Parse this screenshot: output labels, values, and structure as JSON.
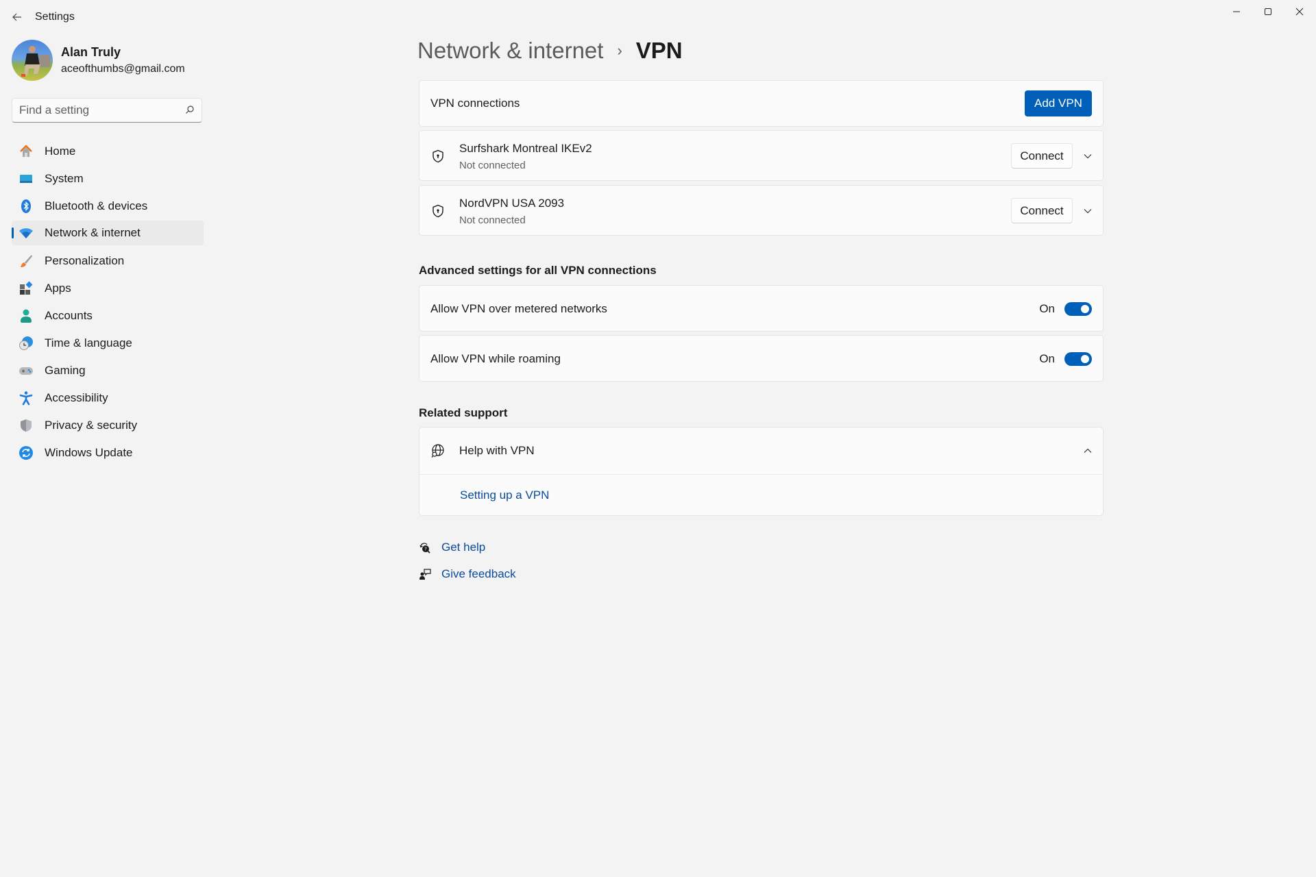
{
  "window": {
    "title": "Settings",
    "controls": [
      "minimize",
      "maximize",
      "close"
    ]
  },
  "profile": {
    "name": "Alan Truly",
    "email": "aceofthumbs@gmail.com"
  },
  "search": {
    "placeholder": "Find a setting",
    "value": ""
  },
  "sidebar": {
    "selected": "Network & internet",
    "items": [
      {
        "label": "Home",
        "icon": "home-icon"
      },
      {
        "label": "System",
        "icon": "system-icon"
      },
      {
        "label": "Bluetooth & devices",
        "icon": "bluetooth-icon"
      },
      {
        "label": "Network & internet",
        "icon": "wifi-icon"
      },
      {
        "label": "Personalization",
        "icon": "brush-icon"
      },
      {
        "label": "Apps",
        "icon": "apps-icon"
      },
      {
        "label": "Accounts",
        "icon": "accounts-icon"
      },
      {
        "label": "Time & language",
        "icon": "time-language-icon"
      },
      {
        "label": "Gaming",
        "icon": "gamepad-icon"
      },
      {
        "label": "Accessibility",
        "icon": "accessibility-icon"
      },
      {
        "label": "Privacy & security",
        "icon": "shield-icon"
      },
      {
        "label": "Windows Update",
        "icon": "update-icon"
      }
    ]
  },
  "breadcrumb": {
    "parent": "Network & internet",
    "separator": "›",
    "current": "VPN"
  },
  "vpn": {
    "header_label": "VPN connections",
    "add_button": "Add VPN",
    "connections": [
      {
        "name": "Surfshark Montreal IKEv2",
        "status": "Not connected",
        "action": "Connect"
      },
      {
        "name": "NordVPN USA 2093",
        "status": "Not connected",
        "action": "Connect"
      }
    ]
  },
  "advanced": {
    "heading": "Advanced settings for all VPN connections",
    "settings": [
      {
        "label": "Allow VPN over metered networks",
        "state_label": "On",
        "enabled": true
      },
      {
        "label": "Allow VPN while roaming",
        "state_label": "On",
        "enabled": true
      }
    ]
  },
  "related": {
    "heading": "Related support",
    "help_title": "Help with VPN",
    "expanded": true,
    "links": [
      "Setting up a VPN"
    ]
  },
  "footer": {
    "get_help": "Get help",
    "give_feedback": "Give feedback"
  },
  "colors": {
    "accent": "#005fb8",
    "link": "#0a4a9b",
    "background": "#f3f3f3",
    "card": "#fbfbfb"
  }
}
